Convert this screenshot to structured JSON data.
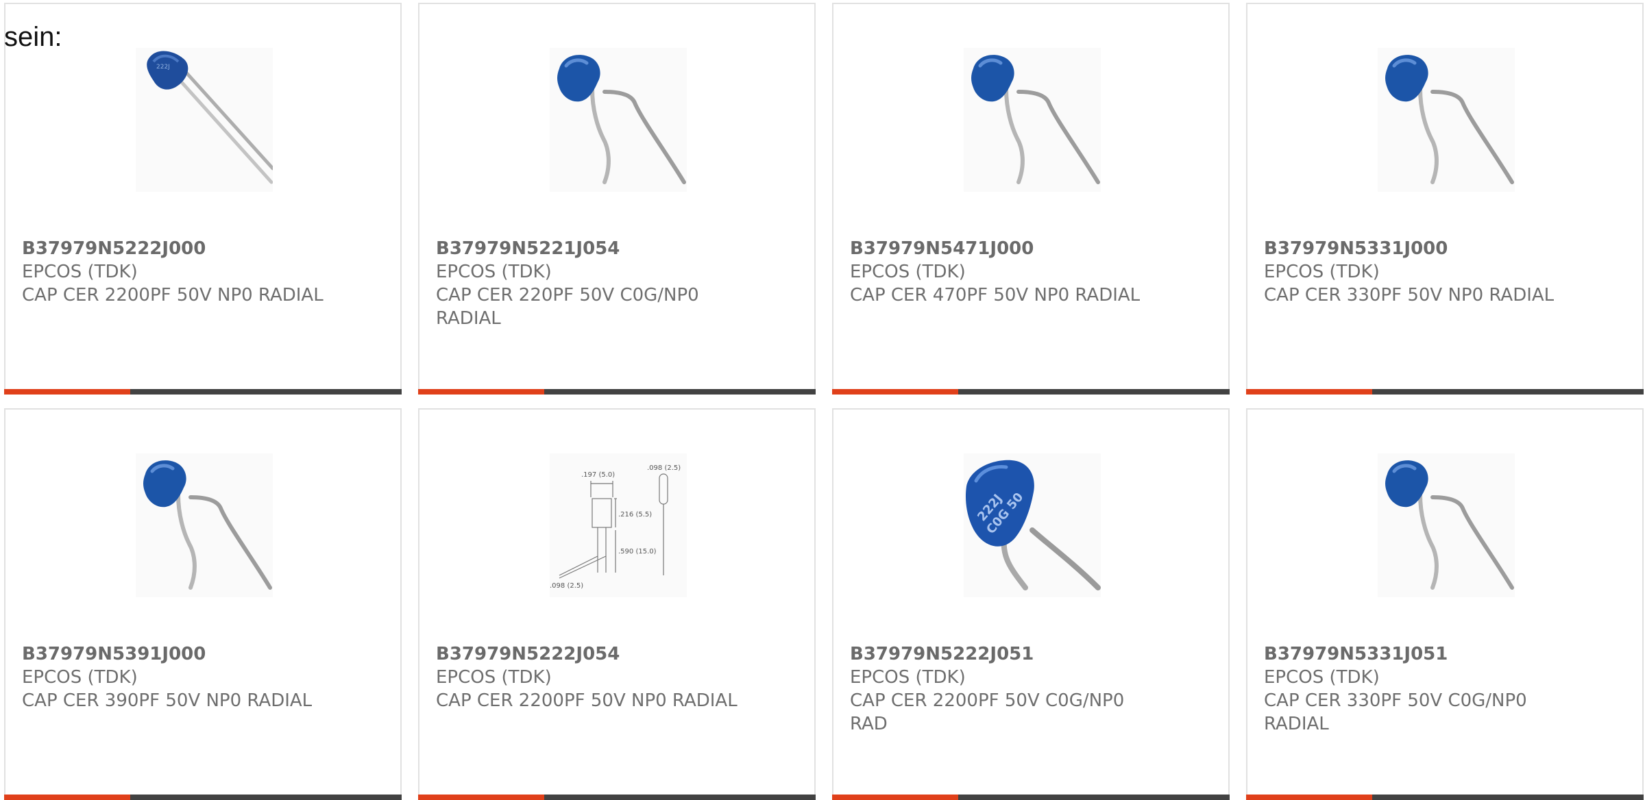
{
  "intro_text": "sein:",
  "colors": {
    "accent": "#e0401a",
    "bar_dark": "#424242",
    "text": "#6e6e6e",
    "border": "#e1e1e1",
    "capacitor_blue": "#1f5aa8"
  },
  "products": [
    {
      "part_number": "B37979N5222J000",
      "manufacturer": "EPCOS (TDK)",
      "description": "CAP CER 2200PF 50V NP0 RADIAL",
      "image": "small-capacitor-photo"
    },
    {
      "part_number": "B37979N5221J054",
      "manufacturer": "EPCOS (TDK)",
      "description": "CAP CER 220PF 50V C0G/NP0 RADIAL",
      "image": "bent-lead-capacitor-photo"
    },
    {
      "part_number": "B37979N5471J000",
      "manufacturer": "EPCOS (TDK)",
      "description": "CAP CER 470PF 50V NP0 RADIAL",
      "image": "bent-lead-capacitor-photo"
    },
    {
      "part_number": "B37979N5331J000",
      "manufacturer": "EPCOS (TDK)",
      "description": "CAP CER 330PF 50V NP0 RADIAL",
      "image": "bent-lead-capacitor-photo"
    },
    {
      "part_number": "B37979N5391J000",
      "manufacturer": "EPCOS (TDK)",
      "description": "CAP CER 390PF 50V NP0 RADIAL",
      "image": "bent-lead-capacitor-photo"
    },
    {
      "part_number": "B37979N5222J054",
      "manufacturer": "EPCOS (TDK)",
      "description": "CAP CER 2200PF 50V NP0 RADIAL",
      "image": "dimension-drawing",
      "drawing_labels": [
        ".197 (5.0)",
        ".098 (2.5)",
        ".216 (5.5)",
        ".590 (15.0)",
        ".098 (2.5)"
      ]
    },
    {
      "part_number": "B37979N5222J051",
      "manufacturer": "EPCOS (TDK)",
      "description": "CAP CER 2200PF 50V C0G/NP0 RAD",
      "image": "large-capacitor-photo",
      "body_marking": [
        "222J",
        "C0G 50"
      ]
    },
    {
      "part_number": "B37979N5331J051",
      "manufacturer": "EPCOS (TDK)",
      "description": "CAP CER 330PF 50V C0G/NP0 RADIAL",
      "image": "bent-lead-capacitor-photo"
    }
  ]
}
